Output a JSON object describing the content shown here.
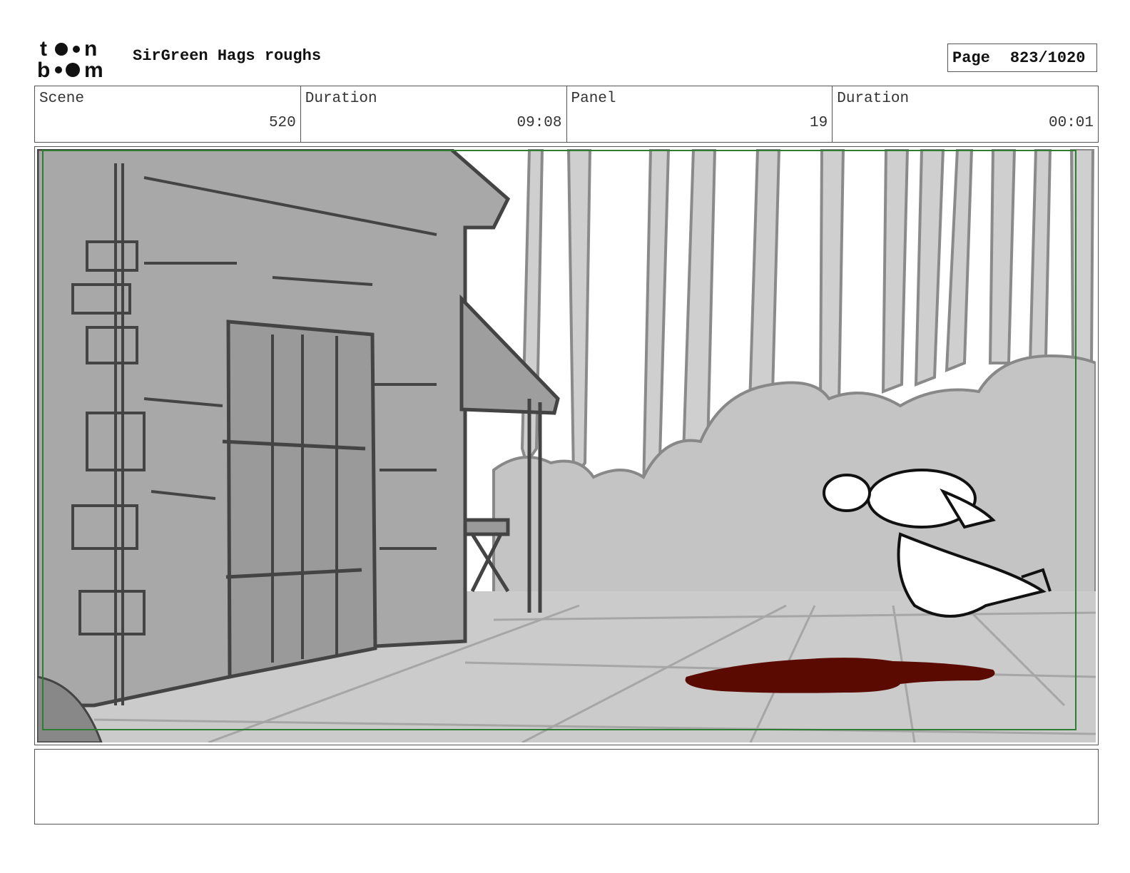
{
  "header": {
    "logo_text": "toonboom",
    "project_title": "SirGreen Hags roughs",
    "page_label": "Page",
    "page_number": "823/1020"
  },
  "info": {
    "scene_label": "Scene",
    "scene_value": "520",
    "scene_duration_label": "Duration",
    "scene_duration_value": "09:08",
    "panel_label": "Panel",
    "panel_value": "19",
    "panel_duration_label": "Duration",
    "panel_duration_value": "00:01"
  },
  "panel": {
    "safe_frame_color": "#2e7d32",
    "blood_color": "#5a0a00"
  },
  "notes": {
    "text": ""
  }
}
